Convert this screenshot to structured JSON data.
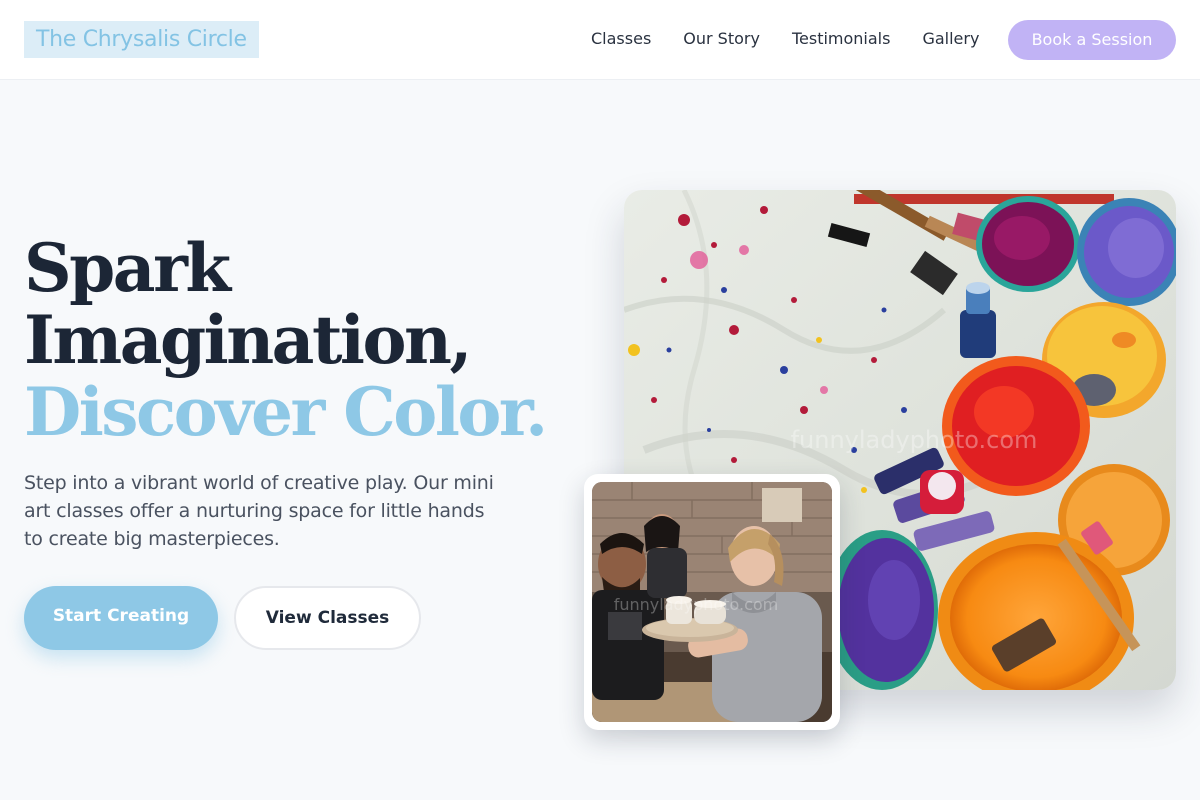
{
  "brand": {
    "name": "The Chrysalis Circle"
  },
  "nav": {
    "items": [
      {
        "label": "Classes"
      },
      {
        "label": "Our Story"
      },
      {
        "label": "Testimonials"
      },
      {
        "label": "Gallery"
      }
    ],
    "cta_label": "Book a Session"
  },
  "hero": {
    "headline_line1": "Spark",
    "headline_line2": "Imagination,",
    "headline_accent": "Discover Color.",
    "subtext": "Step into a vibrant world of creative play. Our mini art classes offer a nurturing space for little hands to create big masterpieces.",
    "primary_button": "Start Creating",
    "secondary_button": "View Classes"
  },
  "images": {
    "main_icon": "paint-supplies-photo",
    "secondary_icon": "pottery-class-photo",
    "main_watermark": "funnyladyphoto.com",
    "secondary_watermark": "funnyladyphoto.com"
  },
  "colors": {
    "accent_blue": "#8ec8e6",
    "cta_purple": "#c1b3f5",
    "heading_dark": "#1c2636"
  }
}
